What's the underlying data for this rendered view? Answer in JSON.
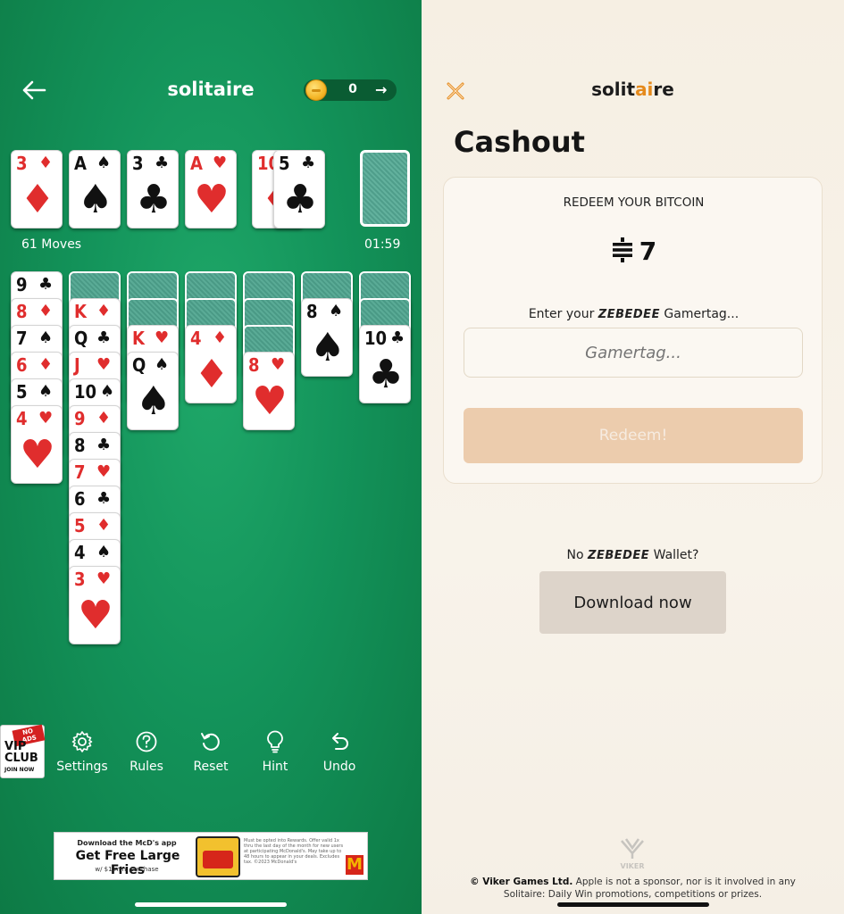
{
  "left": {
    "title": "solitaire",
    "coins": "0",
    "coin_arrow": "→",
    "moves": "61 Moves",
    "timer": "01:59",
    "foundation": [
      {
        "rank": "3",
        "suit": "♦",
        "color": "red"
      },
      {
        "rank": "A",
        "suit": "♠",
        "color": "blk"
      },
      {
        "rank": "3",
        "suit": "♣",
        "color": "blk"
      },
      {
        "rank": "A",
        "suit": "♥",
        "color": "red"
      }
    ],
    "waste": [
      {
        "rank": "10",
        "suit": "♦",
        "color": "red"
      },
      {
        "rank": "5",
        "suit": "♣",
        "color": "blk"
      }
    ],
    "tableau": [
      {
        "backs": 0,
        "cards": [
          {
            "rank": "9",
            "suit": "♣",
            "color": "blk"
          },
          {
            "rank": "8",
            "suit": "♦",
            "color": "red"
          },
          {
            "rank": "7",
            "suit": "♠",
            "color": "blk"
          },
          {
            "rank": "6",
            "suit": "♦",
            "color": "red"
          },
          {
            "rank": "5",
            "suit": "♠",
            "color": "blk"
          },
          {
            "rank": "4",
            "suit": "♥",
            "color": "red"
          }
        ]
      },
      {
        "backs": 1,
        "cards": [
          {
            "rank": "K",
            "suit": "♦",
            "color": "red"
          },
          {
            "rank": "Q",
            "suit": "♣",
            "color": "blk"
          },
          {
            "rank": "J",
            "suit": "♥",
            "color": "red"
          },
          {
            "rank": "10",
            "suit": "♠",
            "color": "blk"
          },
          {
            "rank": "9",
            "suit": "♦",
            "color": "red"
          },
          {
            "rank": "8",
            "suit": "♣",
            "color": "blk"
          },
          {
            "rank": "7",
            "suit": "♥",
            "color": "red"
          },
          {
            "rank": "6",
            "suit": "♣",
            "color": "blk"
          },
          {
            "rank": "5",
            "suit": "♦",
            "color": "red"
          },
          {
            "rank": "4",
            "suit": "♠",
            "color": "blk"
          },
          {
            "rank": "3",
            "suit": "♥",
            "color": "red"
          }
        ]
      },
      {
        "backs": 2,
        "cards": [
          {
            "rank": "K",
            "suit": "♥",
            "color": "red"
          },
          {
            "rank": "Q",
            "suit": "♠",
            "color": "blk"
          }
        ]
      },
      {
        "backs": 2,
        "cards": [
          {
            "rank": "4",
            "suit": "♦",
            "color": "red"
          }
        ]
      },
      {
        "backs": 3,
        "cards": [
          {
            "rank": "8",
            "suit": "♥",
            "color": "red"
          }
        ]
      },
      {
        "backs": 1,
        "cards": [
          {
            "rank": "8",
            "suit": "♠",
            "color": "blk"
          }
        ]
      },
      {
        "backs": 2,
        "cards": [
          {
            "rank": "10",
            "suit": "♣",
            "color": "blk"
          }
        ]
      }
    ],
    "toolbar": {
      "vip_noads": "NO ADS",
      "vip_label_1": "VIP",
      "vip_label_2": "CLUB",
      "vip_join": "JOIN NOW",
      "settings": "Settings",
      "rules": "Rules",
      "reset": "Reset",
      "hint": "Hint",
      "undo": "Undo"
    },
    "ad": {
      "line1": "Download the McD's app",
      "line2": "Get Free Large Fries",
      "line3": "w/ $1 min. purchase",
      "fine": "Must be opted into Rewards. Offer valid 1x thru the last day of the month for new users at participating McDonald's. May take up to 48 hours to appear in your deals. Excludes tax. ©2023 McDonald's",
      "logo": "M"
    }
  },
  "right": {
    "title_pre": "solit",
    "title_ai": "ai",
    "title_post": "re",
    "heading": "Cashout",
    "redeem_heading": "REDEEM YOUR BITCOIN",
    "amount": "7",
    "enter_pre": "Enter your ",
    "brand": "ZEBEDEE",
    "enter_post": " Gamertag...",
    "gamertag_placeholder": "Gamertag...",
    "redeem_button": "Redeem!",
    "no_wallet_pre": "No ",
    "no_wallet_post": " Wallet?",
    "download_button": "Download now",
    "footer_company": "© Viker Games Ltd.",
    "footer_text": " Apple is not a sponsor, nor is it involved in any Solitaire: Daily Win promotions, competitions or prizes.",
    "viker_label": "VIKER",
    "colors": {
      "accent": "#e58a1c",
      "redeem_disabled": "#ecccad"
    }
  }
}
